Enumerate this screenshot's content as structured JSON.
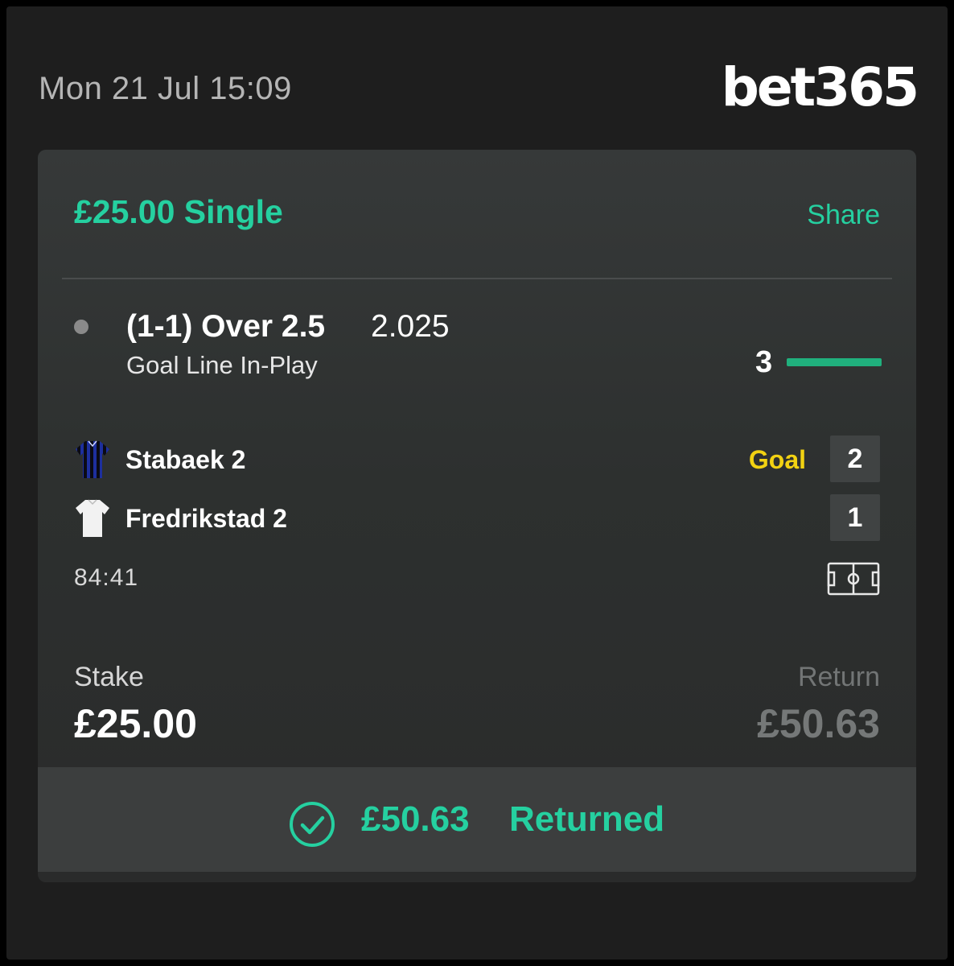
{
  "header": {
    "datetime": "Mon 21 Jul 15:09",
    "brand": "bet365"
  },
  "bet": {
    "title": "£25.00 Single",
    "share_label": "Share",
    "selection": "(1-1) Over 2.5",
    "odds": "2.025",
    "market": "Goal Line In-Play",
    "goal_count": "3",
    "progress_fraction": 1.0
  },
  "match": {
    "home": {
      "name": "Stabaek 2",
      "score": "2",
      "event": "Goal",
      "kit_icon": "striped-blue-shirt-icon"
    },
    "away": {
      "name": "Fredrikstad 2",
      "score": "1",
      "kit_icon": "white-shirt-icon"
    },
    "clock": "84:41",
    "pitch_icon": "pitch-icon"
  },
  "stake": {
    "label": "Stake",
    "value": "£25.00"
  },
  "return": {
    "label": "Return",
    "value": "£50.63"
  },
  "returned": {
    "amount": "£50.63",
    "label": "Returned",
    "icon": "check-circle-icon"
  },
  "colors": {
    "accent": "#25d0a0",
    "goal": "#f2d212",
    "card": "#2d302f",
    "background": "#1e1e1e",
    "progress": "#20b07d"
  }
}
